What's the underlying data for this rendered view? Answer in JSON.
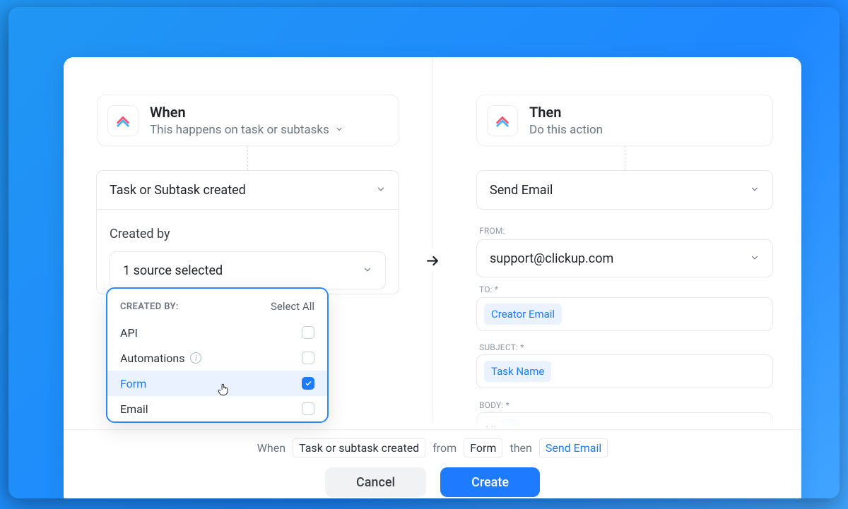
{
  "when": {
    "title": "When",
    "subtitle": "This happens on task or subtasks",
    "trigger": "Task or Subtask created",
    "created_by_label": "Created by",
    "source_selected": "1 source selected",
    "dropdown_header": "CREATED BY:",
    "select_all": "Select All",
    "options": {
      "api": "API",
      "automations": "Automations",
      "form": "Form",
      "email": "Email"
    }
  },
  "then": {
    "title": "Then",
    "subtitle": "Do this action",
    "action": "Send Email",
    "from_label": "FROM:",
    "from_value": "support@clickup.com",
    "to_label": "TO: *",
    "to_token": "Creator Email",
    "subject_label": "SUBJECT: *",
    "subject_token": "Task Name",
    "body_label": "BODY: *",
    "body_prefix": "Hi"
  },
  "summary": {
    "when": "When",
    "trigger_chip": "Task or subtask created",
    "from": "from",
    "source_chip": "Form",
    "then": "then",
    "action_chip": "Send Email"
  },
  "buttons": {
    "cancel": "Cancel",
    "create": "Create"
  }
}
